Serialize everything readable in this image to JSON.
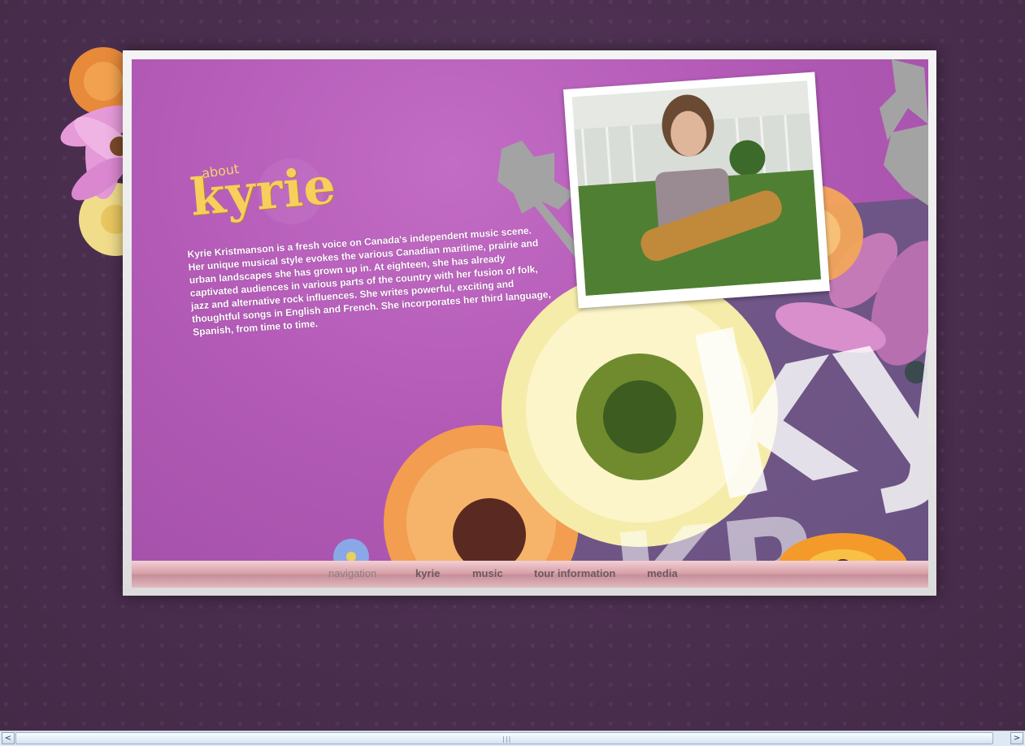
{
  "header": {
    "about": "about",
    "title": "kyrie"
  },
  "bio": {
    "text": "Kyrie Kristmanson is a fresh voice on Canada's independent music scene. Her unique musical style evokes the various Canadian maritime, prairie and urban landscapes she has grown up in. At eighteen, she has already captivated audiences in various parts of the country with her fusion of folk, jazz and alternative rock influences. She writes powerful, exciting and thoughtful songs in English and French. She incorporates her third language, Spanish, from time to time."
  },
  "collage": {
    "big_text_1": "ky",
    "big_text_2": "KR"
  },
  "nav": {
    "label": "navigation",
    "items": [
      {
        "label": "kyrie"
      },
      {
        "label": "music"
      },
      {
        "label": "tour information"
      },
      {
        "label": "media"
      }
    ]
  },
  "scrollbar": {
    "left_arrow": "<",
    "right_arrow": ">",
    "grip": "|||"
  },
  "colors": {
    "page_background": "#4b2e4f",
    "panel_purple": "#b25ab6",
    "title_yellow": "#f7cf5a",
    "nav_pink": "#d9a2aa"
  },
  "icons": {
    "flower": "flower-icon",
    "left_arrow": "scroll-left-arrow-icon",
    "right_arrow": "scroll-right-arrow-icon"
  }
}
